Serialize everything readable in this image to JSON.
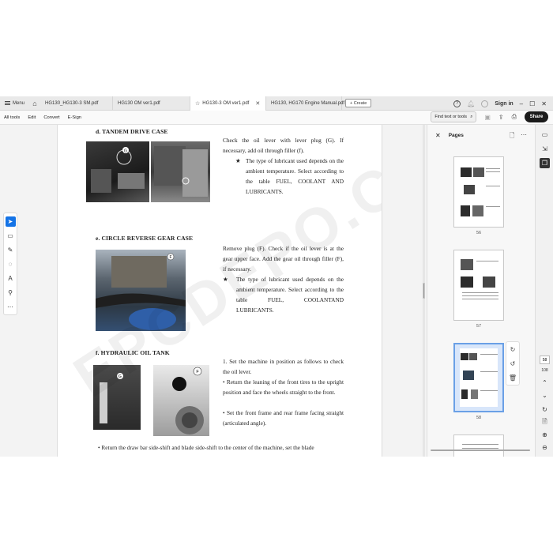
{
  "tabbar": {
    "menu_label": "Menu",
    "tabs": [
      {
        "label": "HG130_HG130-3 SM.pdf",
        "active": false
      },
      {
        "label": "HG130 OM ver1.pdf",
        "active": false
      },
      {
        "label": "HG130-3 OM ver1.pdf",
        "active": true
      },
      {
        "label": "HG130, HG170 Engine Manual.pdf",
        "active": false
      }
    ],
    "create_label": "+ Create",
    "sign_in": "Sign in"
  },
  "toolbar": {
    "items": [
      "All tools",
      "Edit",
      "Convert",
      "E-Sign"
    ],
    "find_placeholder": "Find text or tools",
    "share_label": "Share"
  },
  "left_tools": [
    "select-icon",
    "comment-icon",
    "pen-icon",
    "lasso-icon",
    "text-icon",
    "stamp-icon",
    "more-icon"
  ],
  "document": {
    "sections": [
      {
        "heading": "d. TANDEM DRIVE CASE",
        "body": "Check the oil lever with lever plug (G). If necessary, add oil through filler (f).",
        "note": "The type of lubricant used depends on the ambient temperature. Select according to the table FUEL, COOLANT AND LUBRICANTS."
      },
      {
        "heading": "e. CIRCLE REVERSE GEAR CASE",
        "body": "Remove plug (F). Check if the oil lever is at the gear upper face. Add the gear oil through filler (F), if necessary.",
        "note": "The type of lubricant used depends on the ambient temperature. Select according to the table FUEL, COOLANTAND LUBRICANTS."
      },
      {
        "heading": "f. HYDRAULIC OIL TANK",
        "step": "1. Set the machine in position as follows to check the oil lever.",
        "b1": "• Return the leaning of the front tires to the upright position and face the wheels straight to the front.",
        "b2": "• Set the front frame and rear frame facing straight (articulated angle).",
        "b3": "• Return the draw bar side-shift and blade side-shift to the center of the machine, set the blade"
      }
    ],
    "photo_labels": [
      "G",
      "f",
      "F",
      "G",
      "F"
    ],
    "watermark": "EPCDEPO.COM"
  },
  "pages_panel": {
    "title": "Pages",
    "thumbs": [
      {
        "number": "56",
        "selected": false
      },
      {
        "number": "57",
        "selected": false
      },
      {
        "number": "58",
        "selected": true
      },
      {
        "number": "",
        "selected": false
      }
    ]
  },
  "rail": {
    "current_page": "58",
    "total_pages": "108"
  }
}
